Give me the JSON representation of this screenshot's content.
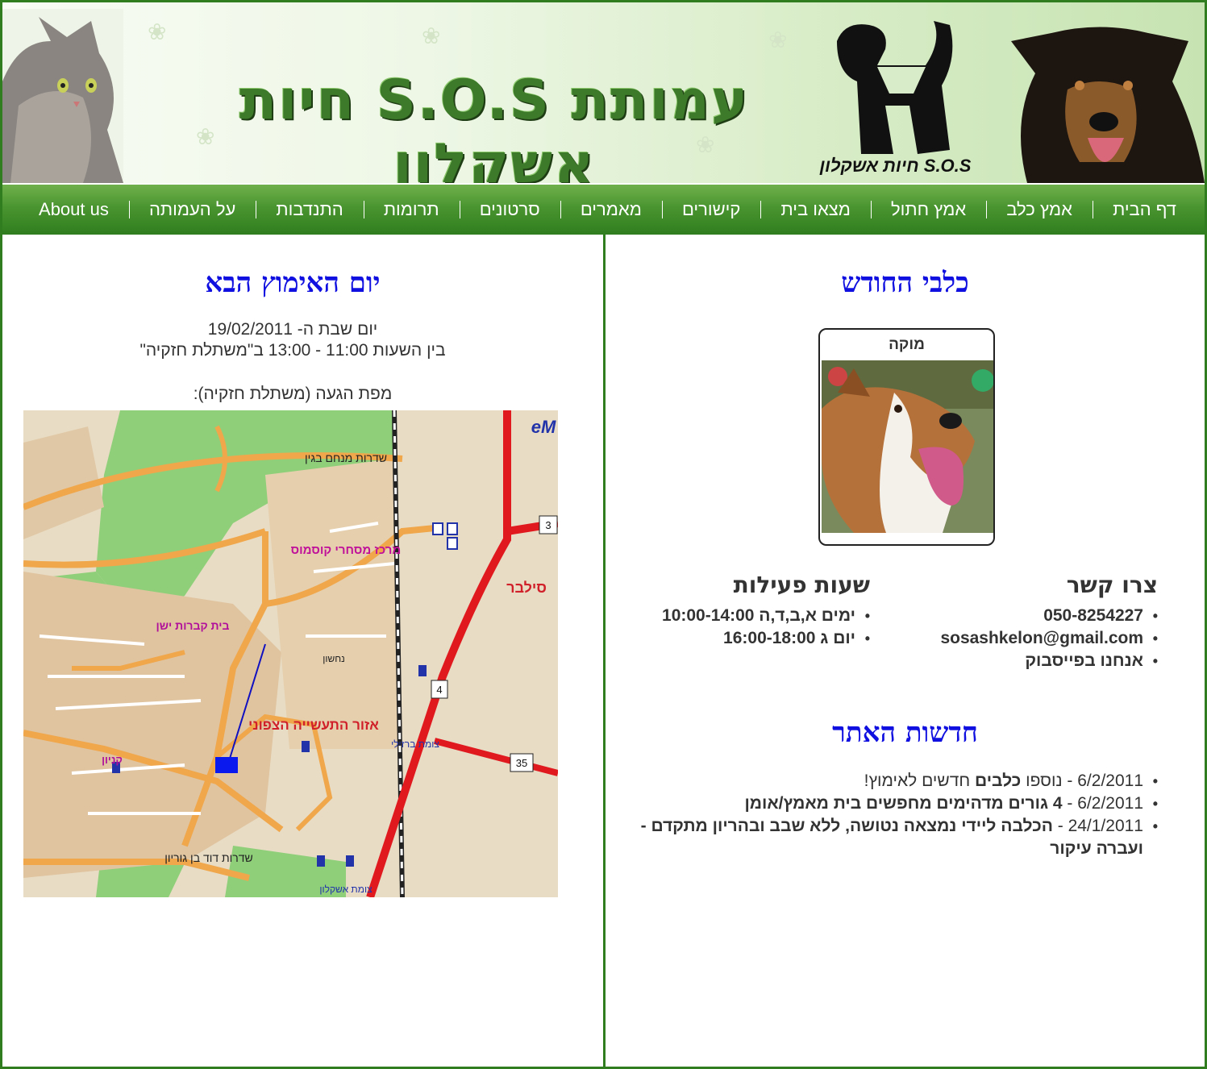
{
  "banner": {
    "title": "עמותת S.O.S חיות אשקלון",
    "logo_text": "S.O.S חיות אשקלון"
  },
  "nav": {
    "items": [
      "דף הבית",
      "אמץ כלב",
      "אמץ חתול",
      "מצאו בית",
      "קישורים",
      "מאמרים",
      "סרטונים",
      "תרומות",
      "התנדבות",
      "על העמותה",
      "About us"
    ]
  },
  "right": {
    "dogs_title": "כלבי החודש",
    "dog_name": "מוקה",
    "contact": {
      "title": "צרו קשר",
      "phone": "050-8254227",
      "email": "sosashkelon@gmail.com",
      "facebook": "אנחנו בפייסבוק"
    },
    "hours": {
      "title": "שעות פעילות",
      "items": [
        "ימים א,ב,ד,ה 10:00-14:00",
        "יום ג 16:00-18:00"
      ]
    },
    "news": {
      "title": "חדשות האתר",
      "items": [
        {
          "date": "6/2/2011",
          "sep": " - ",
          "p1": "נוספו ",
          "b1": "כלבים",
          "p2": " חדשים לאימוץ!"
        },
        {
          "date": "6/2/2011",
          "sep": " - ",
          "p1": "",
          "b1": "4 גורים מדהימים מחפשים בית מאמץ/אומן",
          "p2": ""
        },
        {
          "date": "24/1/2011",
          "sep": " - ",
          "p1": "",
          "b1": "הכלבה ליידי נמצאה נטושה, ללא שבב ובהריון מתקדם - ועברה עיקור",
          "p2": ""
        }
      ]
    }
  },
  "left": {
    "title": "יום האימוץ הבא",
    "line1": "יום שבת ה- 19/02/2011",
    "line2": "בין השעות 11:00 - 13:00 ב\"משתלת חזקיה\"",
    "map_caption": "מפת הגעה (משתלת חזקיה):",
    "map": {
      "labels": {
        "boulevard_begin": "שדרות מנחם בגין",
        "cosmos": "מרכז מסחרי קוסמוס",
        "silver": "סילבר",
        "cemetery": "בית קברות ישן",
        "industrial": "אזור התעשייה הצפוני",
        "barzilai": "צומת ברזילי",
        "ashkelon_junction": "צומת אשקלון",
        "ben_gurion": "שדרות דוד בן גוריון",
        "nahshon": "נחשון",
        "kanyon": "קניון",
        "route3": "3",
        "route4": "4",
        "route35": "35",
        "emap": "eM"
      }
    }
  }
}
